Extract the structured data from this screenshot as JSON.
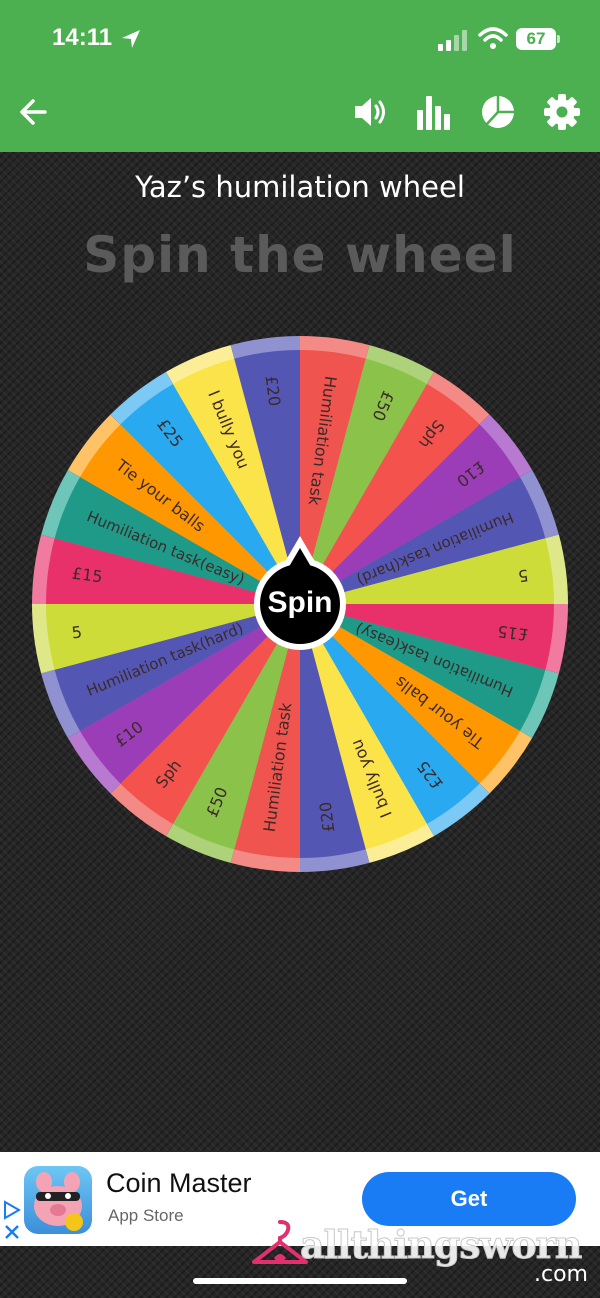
{
  "status_bar": {
    "time": "14:11",
    "battery": "67"
  },
  "toolbar": {
    "back_icon": "back-arrow-icon",
    "icons": [
      "volume-icon",
      "bar-chart-icon",
      "pie-chart-icon",
      "settings-gear-icon"
    ]
  },
  "wheel": {
    "title": "Yaz’s humilation wheel",
    "heading": "Spin the wheel",
    "spin_label": "Spin",
    "segments": [
      {
        "label": "Humiliation task",
        "color": "#f0544f"
      },
      {
        "label": "£50",
        "color": "#8bc34a"
      },
      {
        "label": "Sph",
        "color": "#f4524d"
      },
      {
        "label": "£10",
        "color": "#9c3db8"
      },
      {
        "label": "Humiliation task(hard)",
        "color": "#5456b3"
      },
      {
        "label": "5",
        "color": "#cddc39"
      },
      {
        "label": "£15",
        "color": "#e8316b"
      },
      {
        "label": "Humiliation task(easy)",
        "color": "#1f9a88"
      },
      {
        "label": "Tie your balls",
        "color": "#ff9800"
      },
      {
        "label": "£25",
        "color": "#29a9ef"
      },
      {
        "label": "I bully you",
        "color": "#fbe34a"
      },
      {
        "label": "£20",
        "color": "#5456b3"
      }
    ],
    "rim_colors": [
      "#f48a85",
      "#aed27a",
      "#f48a85",
      "#b87ad0",
      "#8f91d0",
      "#dfe888",
      "#f07aa0",
      "#6ec6b8",
      "#ffc266",
      "#7cc9f5",
      "#fcee96",
      "#8f91d0"
    ]
  },
  "ad": {
    "app_name": "Coin Master",
    "store": "App Store",
    "cta": "Get"
  },
  "watermark": {
    "text": "allthingsworn",
    "suffix": ".com"
  }
}
